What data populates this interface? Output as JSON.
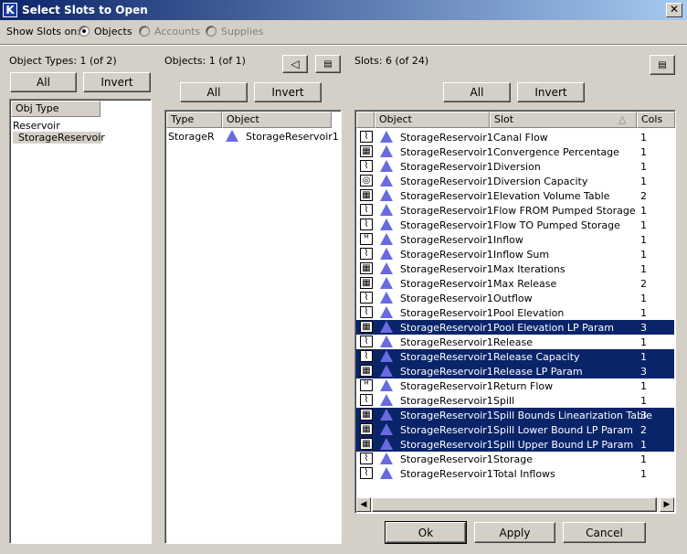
{
  "window": {
    "title": "Select Slots to Open"
  },
  "show_slots": {
    "label": "Show Slots on:",
    "options": [
      {
        "label": "Objects",
        "checked": true,
        "enabled": true
      },
      {
        "label": "Accounts",
        "checked": false,
        "enabled": false
      },
      {
        "label": "Supplies",
        "checked": false,
        "enabled": false
      }
    ]
  },
  "object_types": {
    "label": "Object Types: 1 (of 2)",
    "all_label": "All",
    "invert_label": "Invert",
    "header": "Obj Type",
    "items": [
      "Reservoir",
      "StorageReservoir"
    ],
    "selected_index": 1
  },
  "objects": {
    "label": "Objects: 1 (of 1)",
    "all_label": "All",
    "invert_label": "Invert",
    "headers": {
      "type": "Type",
      "object": "Object"
    },
    "rows": [
      {
        "type": "StorageR",
        "object": "StorageReservoir1"
      }
    ]
  },
  "slots": {
    "label": "Slots: 6 (of 24)",
    "all_label": "All",
    "invert_label": "Invert",
    "headers": {
      "object": "Object",
      "slot": "Slot",
      "cols": "Cols"
    },
    "rows": [
      {
        "icon": "series",
        "object": "StorageReservoir1",
        "slot": "Canal Flow",
        "cols": "1",
        "selected": false
      },
      {
        "icon": "table",
        "object": "StorageReservoir1",
        "slot": "Convergence Percentage",
        "cols": "1",
        "selected": false
      },
      {
        "icon": "series",
        "object": "StorageReservoir1",
        "slot": "Diversion",
        "cols": "1",
        "selected": false
      },
      {
        "icon": "agg",
        "object": "StorageReservoir1",
        "slot": "Diversion Capacity",
        "cols": "1",
        "selected": false
      },
      {
        "icon": "table",
        "object": "StorageReservoir1",
        "slot": "Elevation Volume Table",
        "cols": "2",
        "selected": false
      },
      {
        "icon": "series",
        "object": "StorageReservoir1",
        "slot": "Flow FROM Pumped Storage",
        "cols": "1",
        "selected": false
      },
      {
        "icon": "series",
        "object": "StorageReservoir1",
        "slot": "Flow TO Pumped Storage",
        "cols": "1",
        "selected": false
      },
      {
        "icon": "multi",
        "object": "StorageReservoir1",
        "slot": "Inflow",
        "cols": "1",
        "selected": false
      },
      {
        "icon": "series",
        "object": "StorageReservoir1",
        "slot": "Inflow Sum",
        "cols": "1",
        "selected": false
      },
      {
        "icon": "table",
        "object": "StorageReservoir1",
        "slot": "Max Iterations",
        "cols": "1",
        "selected": false
      },
      {
        "icon": "table",
        "object": "StorageReservoir1",
        "slot": "Max Release",
        "cols": "2",
        "selected": false
      },
      {
        "icon": "series",
        "object": "StorageReservoir1",
        "slot": "Outflow",
        "cols": "1",
        "selected": false
      },
      {
        "icon": "series",
        "object": "StorageReservoir1",
        "slot": "Pool Elevation",
        "cols": "1",
        "selected": false
      },
      {
        "icon": "table",
        "object": "StorageReservoir1",
        "slot": "Pool Elevation LP Param",
        "cols": "3",
        "selected": true
      },
      {
        "icon": "series",
        "object": "StorageReservoir1",
        "slot": "Release",
        "cols": "1",
        "selected": false
      },
      {
        "icon": "series",
        "object": "StorageReservoir1",
        "slot": "Release Capacity",
        "cols": "1",
        "selected": true
      },
      {
        "icon": "table",
        "object": "StorageReservoir1",
        "slot": "Release LP Param",
        "cols": "3",
        "selected": true
      },
      {
        "icon": "multi",
        "object": "StorageReservoir1",
        "slot": "Return Flow",
        "cols": "1",
        "selected": false
      },
      {
        "icon": "series",
        "object": "StorageReservoir1",
        "slot": "Spill",
        "cols": "1",
        "selected": false
      },
      {
        "icon": "table",
        "object": "StorageReservoir1",
        "slot": "Spill Bounds Linearization Table",
        "cols": "3",
        "selected": true
      },
      {
        "icon": "table",
        "object": "StorageReservoir1",
        "slot": "Spill Lower Bound LP Param",
        "cols": "2",
        "selected": true
      },
      {
        "icon": "table",
        "object": "StorageReservoir1",
        "slot": "Spill Upper Bound LP Param",
        "cols": "1",
        "selected": true
      },
      {
        "icon": "series",
        "object": "StorageReservoir1",
        "slot": "Storage",
        "cols": "1",
        "selected": false
      },
      {
        "icon": "series",
        "object": "StorageReservoir1",
        "slot": "Total Inflows",
        "cols": "1",
        "selected": false
      }
    ]
  },
  "footer": {
    "ok_label": "Ok",
    "apply_label": "Apply",
    "cancel_label": "Cancel"
  },
  "colors": {
    "selection": "#0a246a",
    "object_icon": "#6a6ae0",
    "title_bar": "#0a246a"
  }
}
